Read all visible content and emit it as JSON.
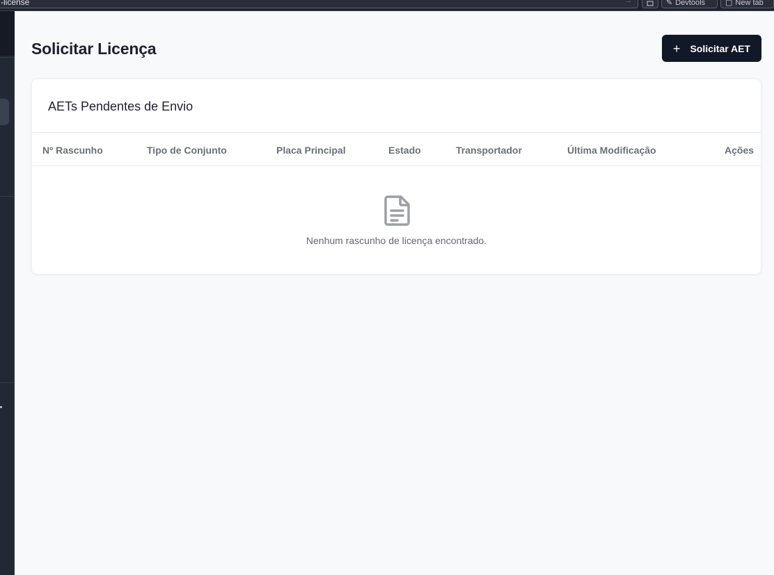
{
  "browser": {
    "url": "-license",
    "devtools_label": "Devtools",
    "new_tab_label": "New tab"
  },
  "page": {
    "title": "Solicitar Licença",
    "primary_action": {
      "icon": "plus-icon",
      "label": "Solicitar AET"
    }
  },
  "card": {
    "title": "AETs Pendentes de Envio",
    "columns": [
      "Nº Rascunho",
      "Tipo de Conjunto",
      "Placa Principal",
      "Estado",
      "Transportador",
      "Última Modificação",
      "Ações"
    ],
    "empty_state": {
      "icon": "document-icon",
      "message": "Nenhum rascunho de licença encontrado."
    }
  },
  "colors": {
    "sidebar": "#222834",
    "primary_button": "#111827",
    "page_background": "#f8f9fb"
  }
}
